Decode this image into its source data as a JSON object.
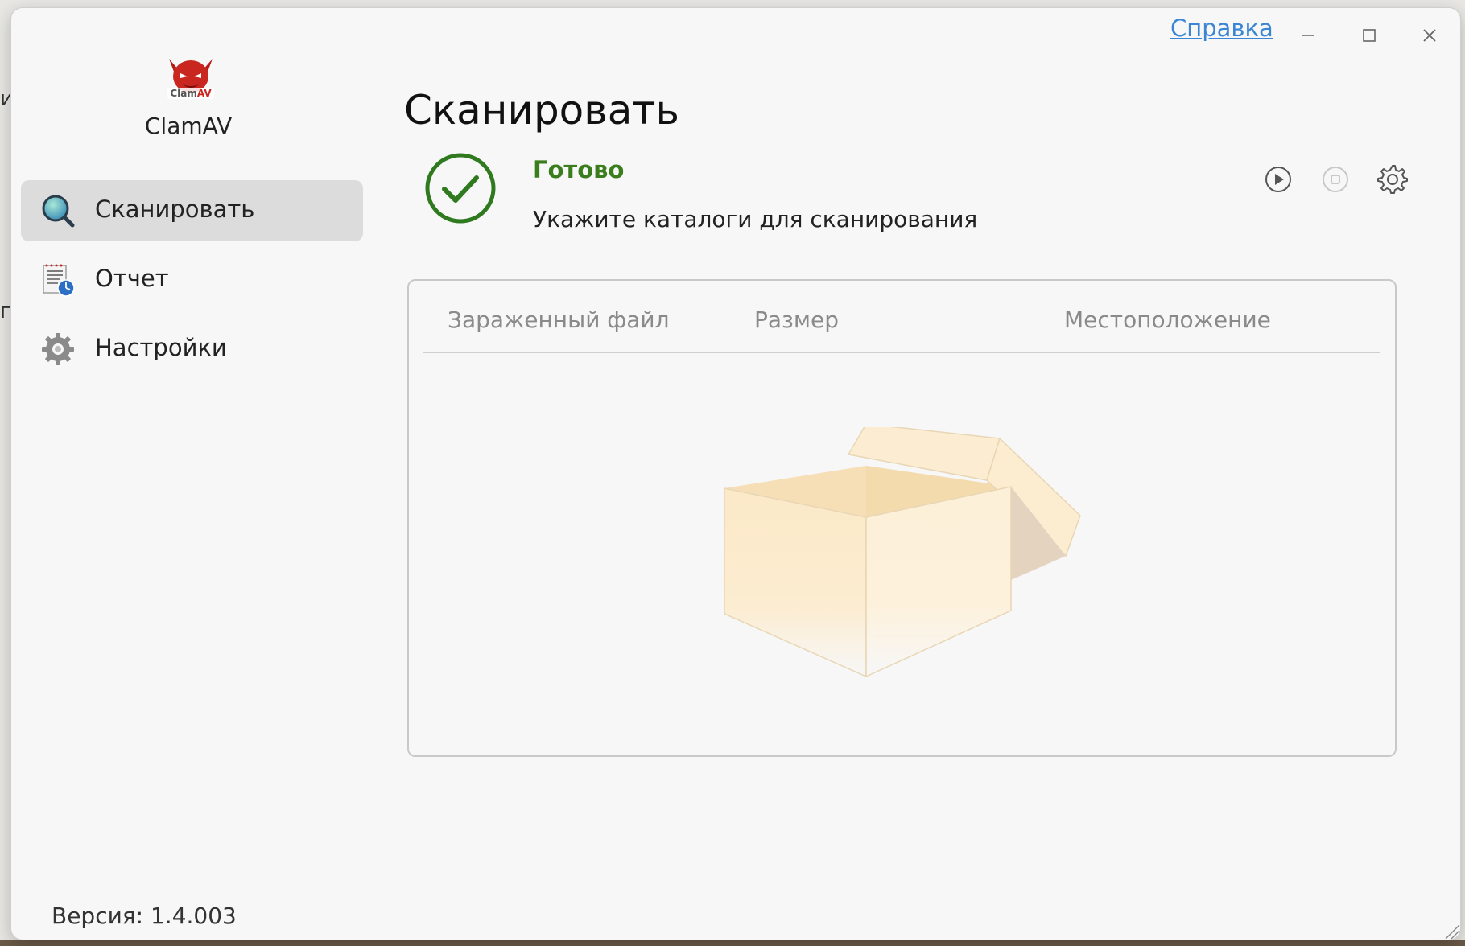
{
  "window": {
    "help_link": "Справка"
  },
  "sidebar": {
    "app_name": "ClamAV",
    "items": [
      {
        "label": "Сканировать",
        "icon": "magnifier-icon",
        "active": true
      },
      {
        "label": "Отчет",
        "icon": "report-clock-icon",
        "active": false
      },
      {
        "label": "Настройки",
        "icon": "gear-icon",
        "active": false
      }
    ],
    "version": "Версия: 1.4.003"
  },
  "main": {
    "title": "Сканировать",
    "status": {
      "text": "Готово",
      "description": "Укажите каталоги для сканирования",
      "icon": "check-circle-icon",
      "color": "#3a7d1c"
    },
    "actions": [
      {
        "name": "start",
        "icon": "play-icon"
      },
      {
        "name": "stop",
        "icon": "stop-icon",
        "disabled": true
      },
      {
        "name": "settings",
        "icon": "gear-icon"
      }
    ],
    "table": {
      "columns": [
        "Зараженный файл",
        "Размер",
        "Местоположение"
      ],
      "rows": [],
      "empty_icon": "empty-box-icon"
    }
  },
  "colors": {
    "accent_link": "#3a86d4",
    "status_green": "#3a7d1c",
    "active_nav_bg": "#dcdcdc"
  }
}
